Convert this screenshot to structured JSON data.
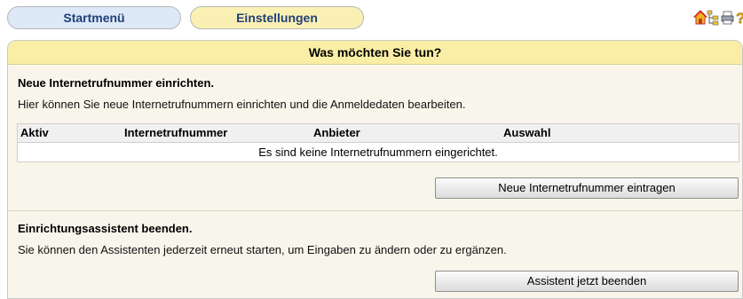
{
  "nav": {
    "tabs": [
      {
        "label": "Startmenü"
      },
      {
        "label": "Einstellungen"
      }
    ],
    "icons": [
      "home-icon",
      "sitemap-icon",
      "printer-icon",
      "help-icon"
    ]
  },
  "panel": {
    "header": "Was möchten Sie tun?",
    "section1": {
      "title": "Neue Internetrufnummer einrichten.",
      "text": "Hier können Sie neue Internetrufnummern einrichten und die Anmeldedaten bearbeiten.",
      "table": {
        "columns": [
          "Aktiv",
          "Internetrufnummer",
          "Anbieter",
          "Auswahl"
        ],
        "empty_message": "Es sind keine Internetrufnummern eingerichtet."
      },
      "button": "Neue Internetrufnummer eintragen"
    },
    "section2": {
      "title": "Einrichtungsassistent beenden.",
      "text": "Sie können den Assistenten jederzeit erneut starten, um Eingaben zu ändern oder zu ergänzen.",
      "button": "Assistent jetzt beenden"
    }
  },
  "colors": {
    "tab_start_bg": "#dde9f7",
    "tab_settings_bg": "#faf0b3",
    "header_bg": "#faeea6",
    "panel_bg": "#f8f5ea",
    "tab_text": "#1f3f78"
  }
}
